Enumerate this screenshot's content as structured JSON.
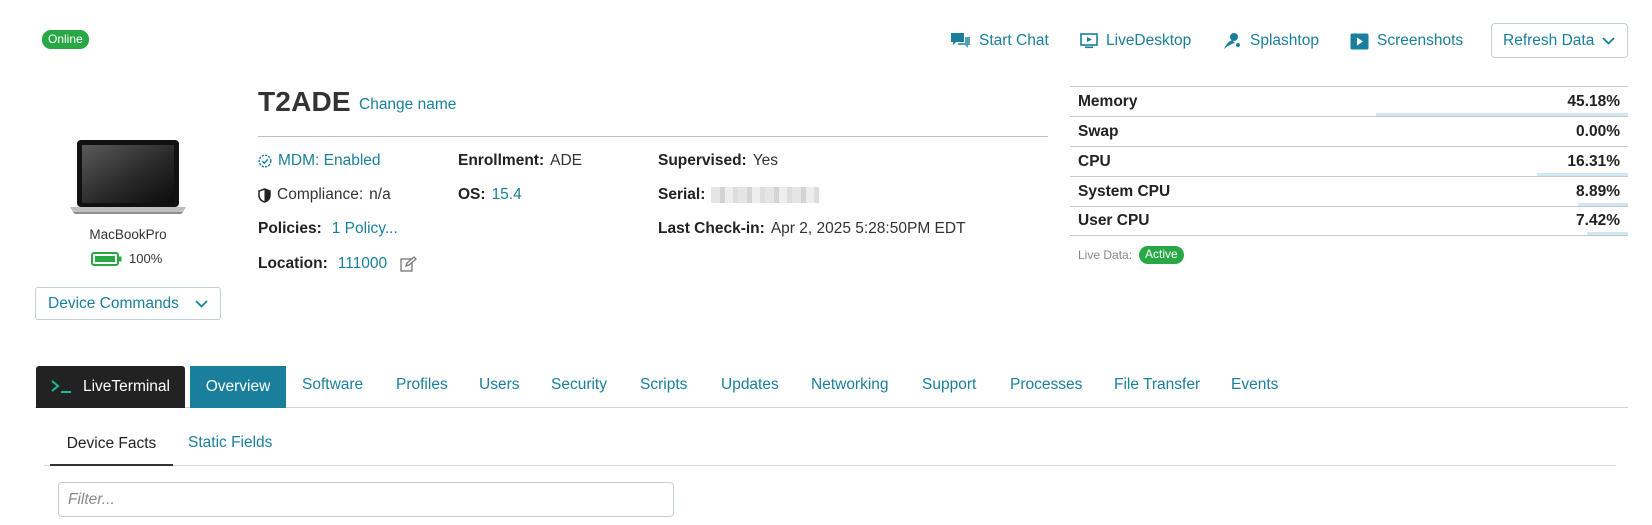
{
  "status": {
    "online": "Online"
  },
  "actions": {
    "start_chat": "Start Chat",
    "live_desktop": "LiveDesktop",
    "splashtop": "Splashtop",
    "screenshots": "Screenshots",
    "refresh": "Refresh Data"
  },
  "device": {
    "model": "MacBookPro",
    "battery": "100%",
    "commands": "Device Commands",
    "name": "T2ADE",
    "change_name": "Change name"
  },
  "details": {
    "mdm": "MDM: Enabled",
    "compliance_label": "Compliance:",
    "compliance_value": "n/a",
    "policies_label": "Policies:",
    "policies_value": "1 Policy...",
    "location_label": "Location:",
    "location_value": "111000",
    "enrollment_label": "Enrollment:",
    "enrollment_value": "ADE",
    "os_label": "OS:",
    "os_value": "15.4",
    "supervised_label": "Supervised:",
    "supervised_value": "Yes",
    "serial_label": "Serial:",
    "checkin_label": "Last Check-in:",
    "checkin_value": "Apr 2, 2025 5:28:50PM EDT"
  },
  "stats": [
    {
      "label": "Memory",
      "value": "45.18%",
      "fraction": 0.4518
    },
    {
      "label": "Swap",
      "value": "0.00%",
      "fraction": 0.0
    },
    {
      "label": "CPU",
      "value": "16.31%",
      "fraction": 0.1631
    },
    {
      "label": "System CPU",
      "value": "8.89%",
      "fraction": 0.0889
    },
    {
      "label": "User CPU",
      "value": "7.42%",
      "fraction": 0.0742
    }
  ],
  "live_data": {
    "label": "Live Data:",
    "status": "Active"
  },
  "tabs": {
    "terminal": "LiveTerminal",
    "items": [
      "Overview",
      "Software",
      "Profiles",
      "Users",
      "Security",
      "Scripts",
      "Updates",
      "Networking",
      "Support",
      "Processes",
      "File Transfer",
      "Events"
    ]
  },
  "subtabs": [
    "Device Facts",
    "Static Fields"
  ],
  "filter": {
    "placeholder": "Filter..."
  },
  "colors": {
    "accent": "#1a7f9c",
    "online": "#28a745",
    "terminal_bg": "#222222"
  }
}
